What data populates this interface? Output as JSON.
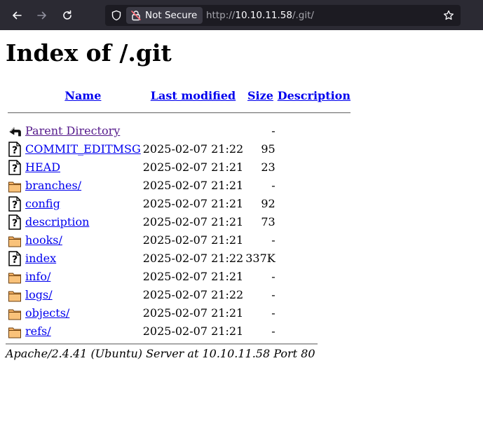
{
  "browser": {
    "security_label": "Not Secure",
    "url": {
      "scheme": "http://",
      "host": "10.10.11.58",
      "path": "/.git/"
    }
  },
  "page": {
    "title": "Index of /.git",
    "columns": {
      "name": "Name",
      "last_modified": "Last modified",
      "size": "Size",
      "description": "Description"
    },
    "parent": {
      "label": "Parent Directory",
      "size": "-"
    },
    "entries": [
      {
        "name": "COMMIT_EDITMSG",
        "modified": "2025-02-07 21:22",
        "size": "95",
        "type": "file"
      },
      {
        "name": "HEAD",
        "modified": "2025-02-07 21:21",
        "size": "23",
        "type": "file"
      },
      {
        "name": "branches/",
        "modified": "2025-02-07 21:21",
        "size": "-",
        "type": "folder"
      },
      {
        "name": "config",
        "modified": "2025-02-07 21:21",
        "size": "92",
        "type": "file"
      },
      {
        "name": "description",
        "modified": "2025-02-07 21:21",
        "size": "73",
        "type": "file"
      },
      {
        "name": "hooks/",
        "modified": "2025-02-07 21:21",
        "size": "-",
        "type": "folder"
      },
      {
        "name": "index",
        "modified": "2025-02-07 21:22",
        "size": "337K",
        "type": "file"
      },
      {
        "name": "info/",
        "modified": "2025-02-07 21:21",
        "size": "-",
        "type": "folder"
      },
      {
        "name": "logs/",
        "modified": "2025-02-07 21:22",
        "size": "-",
        "type": "folder"
      },
      {
        "name": "objects/",
        "modified": "2025-02-07 21:21",
        "size": "-",
        "type": "folder"
      },
      {
        "name": "refs/",
        "modified": "2025-02-07 21:21",
        "size": "-",
        "type": "folder"
      }
    ],
    "footer": "Apache/2.4.41 (Ubuntu) Server at 10.10.11.58 Port 80"
  }
}
